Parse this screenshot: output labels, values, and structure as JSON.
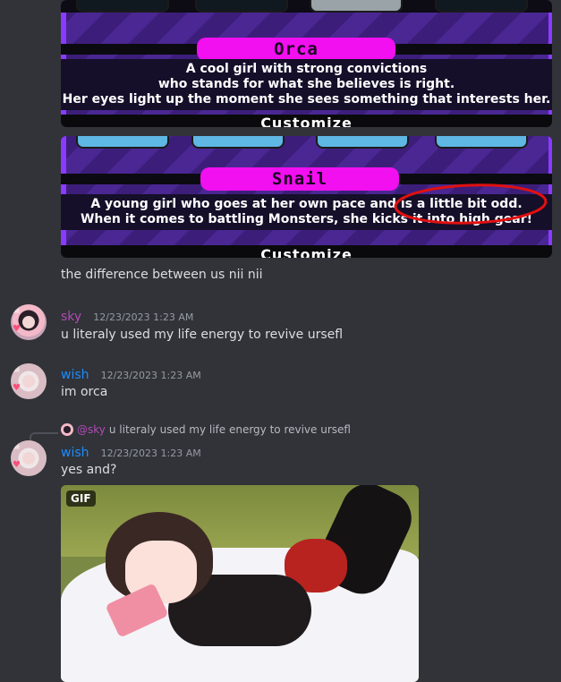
{
  "cards": [
    {
      "name": "Orca",
      "description": [
        "A cool girl with strong convictions",
        "who stands for what she believes is right.",
        "Her eyes light up the moment she sees something that interests her."
      ],
      "customize_label": "Customize"
    },
    {
      "name": "Snail",
      "description": [
        "A young girl who goes at her own pace and is a little bit odd.",
        "When it comes to battling Monsters, she kicks it into high gear!"
      ],
      "customize_label": "Customize"
    }
  ],
  "messages": [
    {
      "text": "the difference between us nii nii"
    },
    {
      "username": "sky",
      "timestamp": "12/23/2023 1:23 AM",
      "text": "u literaly used my life energy to revive ursefl"
    },
    {
      "username": "wish",
      "timestamp": "12/23/2023 1:23 AM",
      "text": "im orca"
    },
    {
      "reply": {
        "mention": "@sky",
        "text": "u literaly used my life energy to revive ursefl"
      },
      "username": "wish",
      "timestamp": "12/23/2023 1:23 AM",
      "text": "yes and?",
      "attachment": {
        "badge": "GIF"
      }
    }
  ],
  "colors": {
    "background": "#313338",
    "sky_username": "#b24ab6",
    "wish_username": "#1d8cff",
    "name_pill": "#f20ff0",
    "annotation_circle": "#e01010"
  }
}
